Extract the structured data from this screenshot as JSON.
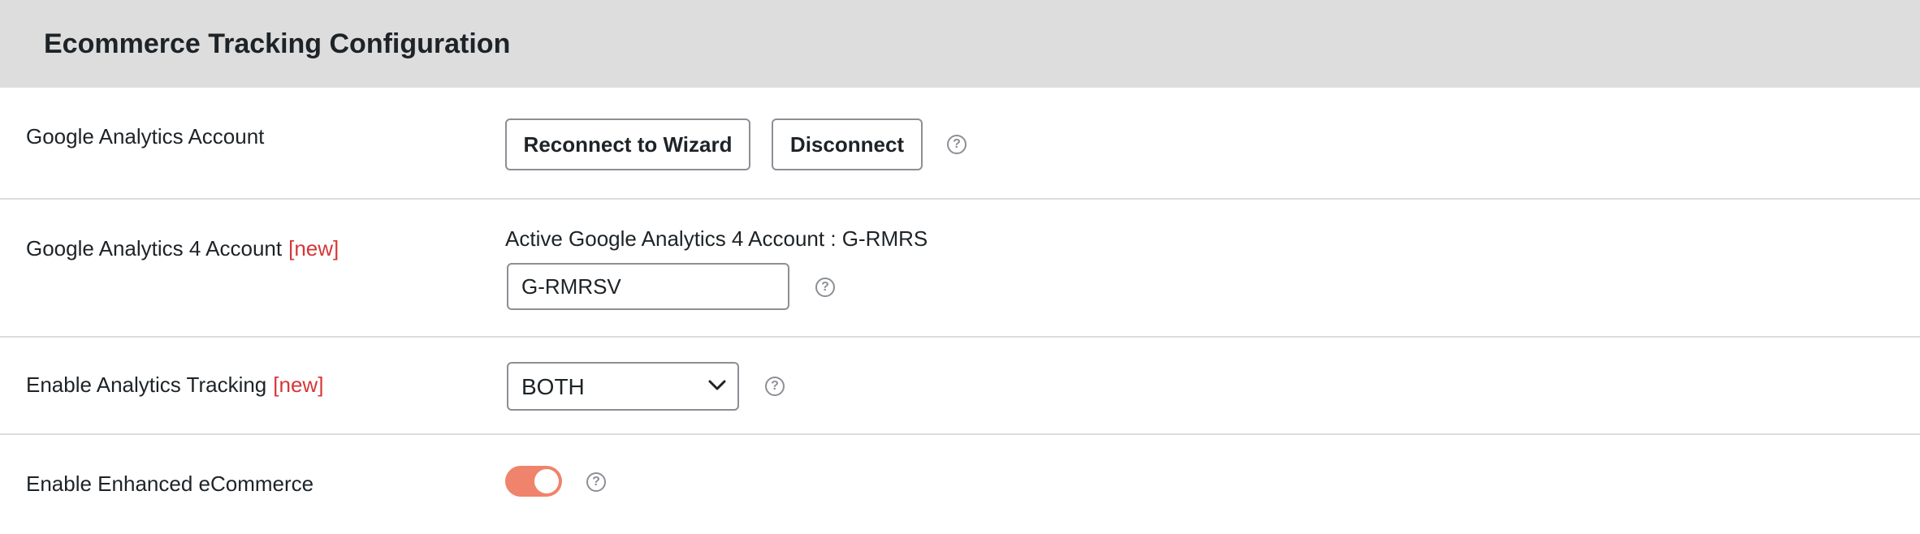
{
  "header": {
    "title": "Ecommerce Tracking Configuration"
  },
  "rows": [
    {
      "label": "Google Analytics Account",
      "buttons": {
        "reconnect": "Reconnect to Wizard",
        "disconnect": "Disconnect"
      },
      "help_icon": "question-circle-icon"
    },
    {
      "label": "Google Analytics 4 Account",
      "tag": "[new]",
      "active_text": "Active Google Analytics 4 Account : G-RMRS",
      "input_value": "G-RMRSV",
      "help_icon": "question-circle-icon"
    },
    {
      "label": "Enable Analytics Tracking",
      "tag": "[new]",
      "select_value": "BOTH",
      "select_icon": "chevron-down-icon",
      "help_icon": "question-circle-icon"
    },
    {
      "label": "Enable Enhanced eCommerce",
      "toggle_on": true,
      "help_icon": "question-circle-icon"
    }
  ],
  "colors": {
    "header_bg": "#dddddd",
    "new_tag": "#d63638",
    "toggle_on": "#f0836b",
    "border": "#8c8f94",
    "divider": "#dcdcde"
  },
  "help_glyph": "?"
}
